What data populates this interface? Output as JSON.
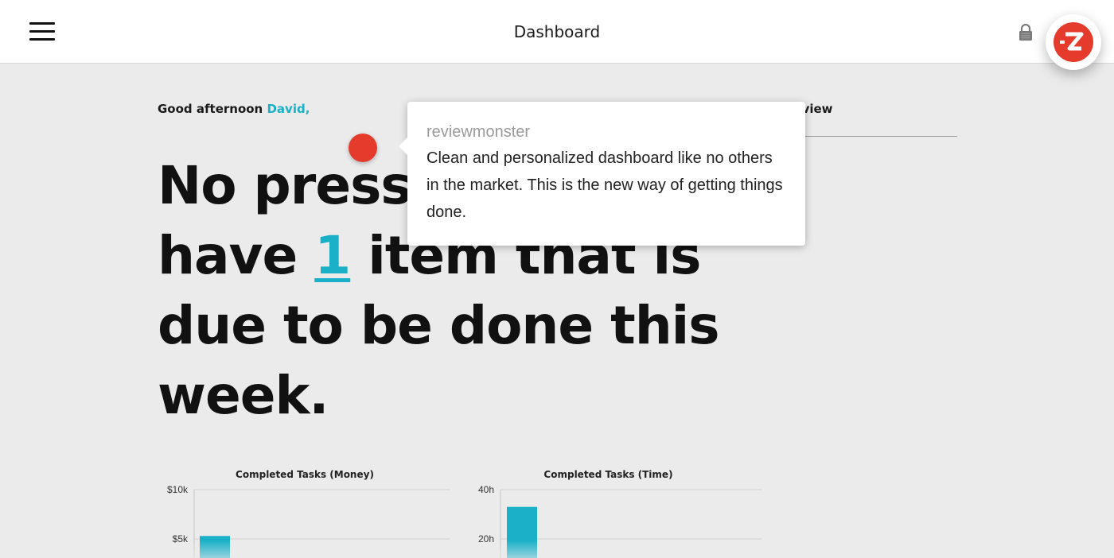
{
  "header": {
    "title": "Dashboard",
    "menu_icon": "hamburger-menu-icon",
    "lock_icon": "lock-icon",
    "app_button_icon": "z-logo-icon",
    "accent_color": "#e53b2c"
  },
  "greeting": {
    "prefix": "Good afternoon ",
    "name": "David,"
  },
  "overview": {
    "label": "erview"
  },
  "headline": {
    "line1": "No press",
    "line2_before": "have ",
    "count": "1",
    "line2_after": " item that is",
    "line3": "due to be done this",
    "line4": "week."
  },
  "tooltip": {
    "author": "reviewmonster",
    "text": "Clean and personalized dashboard like no others in the market. This is the new way of getting things done."
  },
  "colors": {
    "accent": "#1ab0c8",
    "marker": "#e53b2c",
    "background": "#ebebeb"
  },
  "chart_data": [
    {
      "type": "bar",
      "title": "Completed Tasks (Money)",
      "y_ticks": [
        "$10k",
        "$5k"
      ],
      "ylim": [
        0,
        10000
      ],
      "values": [
        5300
      ],
      "color": "#1ab0c8"
    },
    {
      "type": "bar",
      "title": "Completed Tasks (Time)",
      "y_ticks": [
        "40h",
        "20h"
      ],
      "ylim": [
        0,
        40
      ],
      "values": [
        33
      ],
      "color": "#1ab0c8"
    }
  ]
}
